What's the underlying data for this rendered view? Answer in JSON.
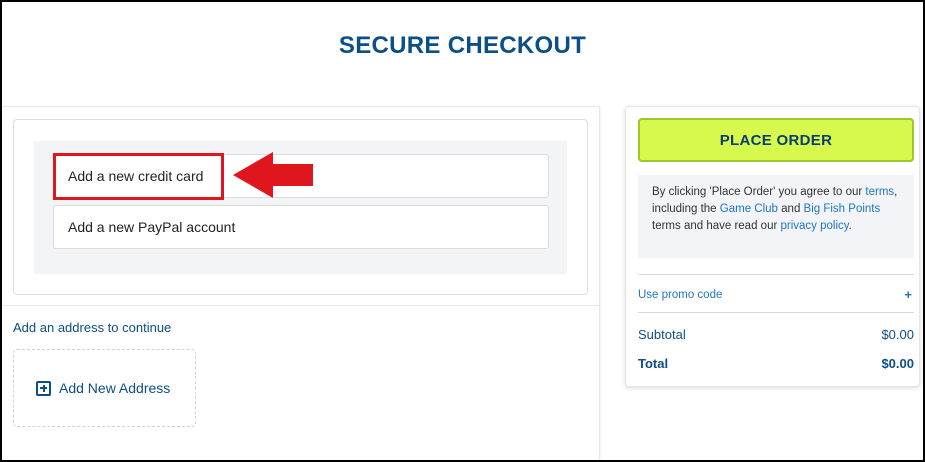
{
  "page": {
    "title": "SECURE CHECKOUT"
  },
  "payment": {
    "options": [
      {
        "label": "Add a new credit card"
      },
      {
        "label": "Add a new PayPal account"
      }
    ]
  },
  "address": {
    "prompt": "Add an address to continue",
    "add_label": "Add New Address"
  },
  "summary": {
    "place_order_label": "PLACE ORDER",
    "agreement": {
      "t1": "By clicking 'Place Order' you agree to our ",
      "link_terms": "terms",
      "t2": ", including the ",
      "link_game_club": "Game Club",
      "t3": " and ",
      "link_big_fish_points": "Big Fish Points",
      "t4": " terms and have read our ",
      "link_privacy": "privacy policy",
      "t5": "."
    },
    "promo_label": "Use promo code",
    "promo_icon": "+",
    "subtotal_label": "Subtotal",
    "subtotal_value": "$0.00",
    "total_label": "Total",
    "total_value": "$0.00"
  },
  "colors": {
    "brand_blue": "#0b4f86",
    "link_blue": "#1f74c7",
    "place_order_green": "#d7f84d",
    "highlight_red": "#e0161e"
  }
}
